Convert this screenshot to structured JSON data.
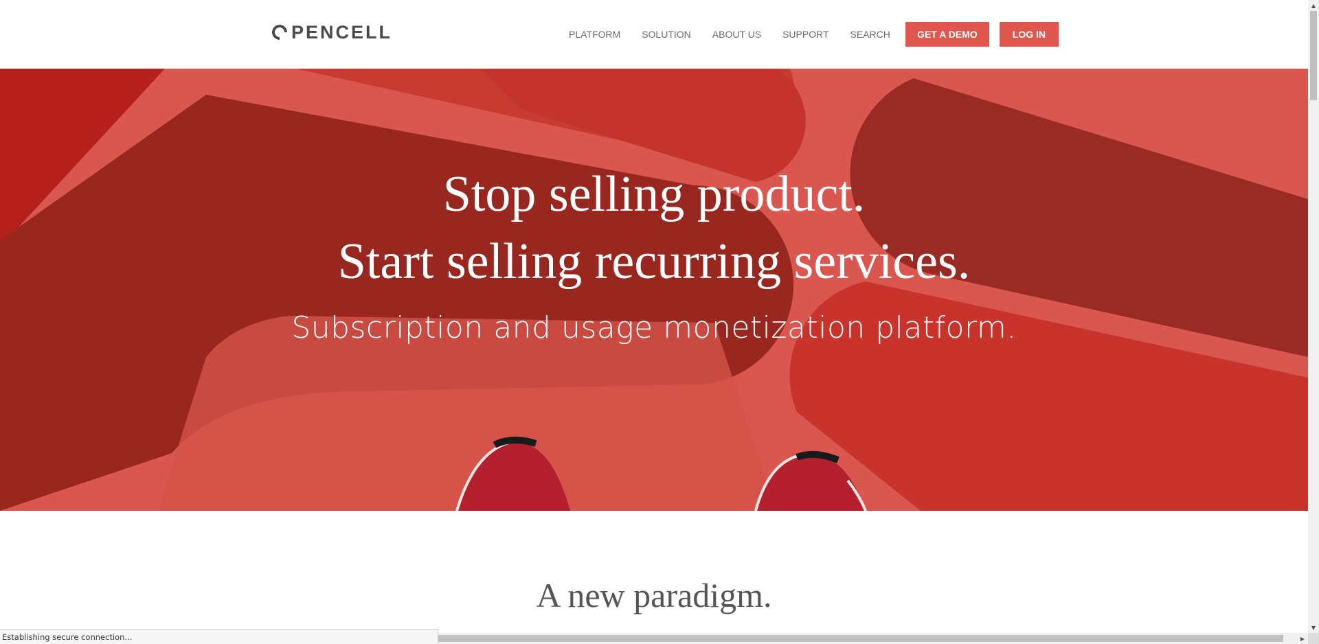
{
  "header": {
    "logo_text": "PENCELL",
    "nav": [
      "PLATFORM",
      "SOLUTION",
      "ABOUT US",
      "SUPPORT",
      "SEARCH"
    ],
    "demo_label": "GET A DEMO",
    "login_label": "LOG IN"
  },
  "hero": {
    "line1": "Stop selling product.",
    "line2": "Start selling recurring services.",
    "subtitle": "Subscription and usage monetization platform."
  },
  "section": {
    "title": "A new paradigm."
  },
  "status_bar": {
    "text": "Establishing secure connection..."
  },
  "colors": {
    "brand": "#e0574f",
    "hero_base": "#d9574e",
    "hero_dark": "#982823",
    "hero_mid": "#c8342c"
  },
  "icons": {
    "logo": "opencell-logo-icon",
    "scroll_up": "scroll-up-arrow-icon",
    "scroll_down": "scroll-down-arrow-icon",
    "scroll_right": "scroll-right-arrow-icon"
  }
}
